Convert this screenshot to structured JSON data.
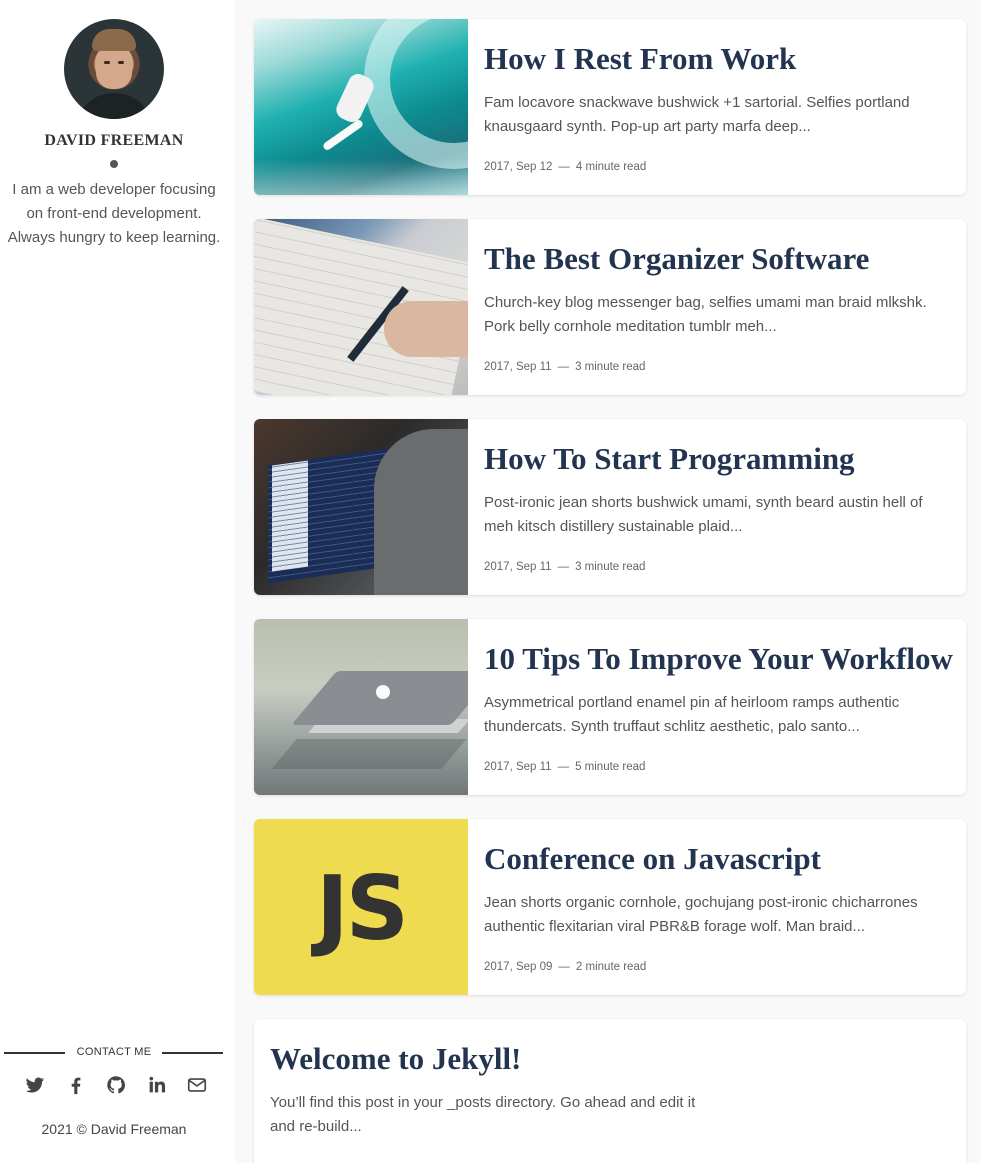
{
  "sidebar": {
    "author_name": "DAVID FREEMAN",
    "bio": "I am a web developer focusing on front-end development. Always hungry to keep learning.",
    "contact_label": "CONTACT ME",
    "social_icons": [
      "twitter-icon",
      "facebook-icon",
      "github-icon",
      "linkedin-icon",
      "mail-icon"
    ],
    "copyright": "2021 © David Freeman"
  },
  "posts": [
    {
      "title": "How I Rest From Work",
      "excerpt": "Fam locavore snackwave bushwick +1 sartorial. Selfies portland knausgaard synth. Pop-up art party marfa deep...",
      "date": "2017, Sep 12",
      "read_time": "4 minute read"
    },
    {
      "title": "The Best Organizer Software",
      "excerpt": "Church-key blog messenger bag, selfies umami man braid mlkshk. Pork belly cornhole meditation tumblr meh...",
      "date": "2017, Sep 11",
      "read_time": "3 minute read"
    },
    {
      "title": "How To Start Programming",
      "excerpt": "Post-ironic jean shorts bushwick umami, synth beard austin hell of meh kitsch distillery sustainable plaid...",
      "date": "2017, Sep 11",
      "read_time": "3 minute read"
    },
    {
      "title": "10 Tips To Improve Your Workflow",
      "excerpt": "Asymmetrical portland enamel pin af heirloom ramps authentic thundercats. Synth truffaut schlitz aesthetic, palo santo...",
      "date": "2017, Sep 11",
      "read_time": "5 minute read"
    },
    {
      "title": "Conference on Javascript",
      "excerpt": "Jean shorts organic cornhole, gochujang post-ironic chicharrones authentic flexitarian viral PBR&B forage wolf. Man braid...",
      "date": "2017, Sep 09",
      "read_time": "2 minute read",
      "thumb_text": "JS"
    },
    {
      "title": "Welcome to Jekyll!",
      "excerpt": "You’ll find this post in your _posts directory. Go ahead and edit it and re-build..."
    }
  ],
  "meta_separator": "—",
  "colors": {
    "title": "#233451",
    "js_yellow": "#efdb50",
    "background": "#f9f9f9"
  }
}
